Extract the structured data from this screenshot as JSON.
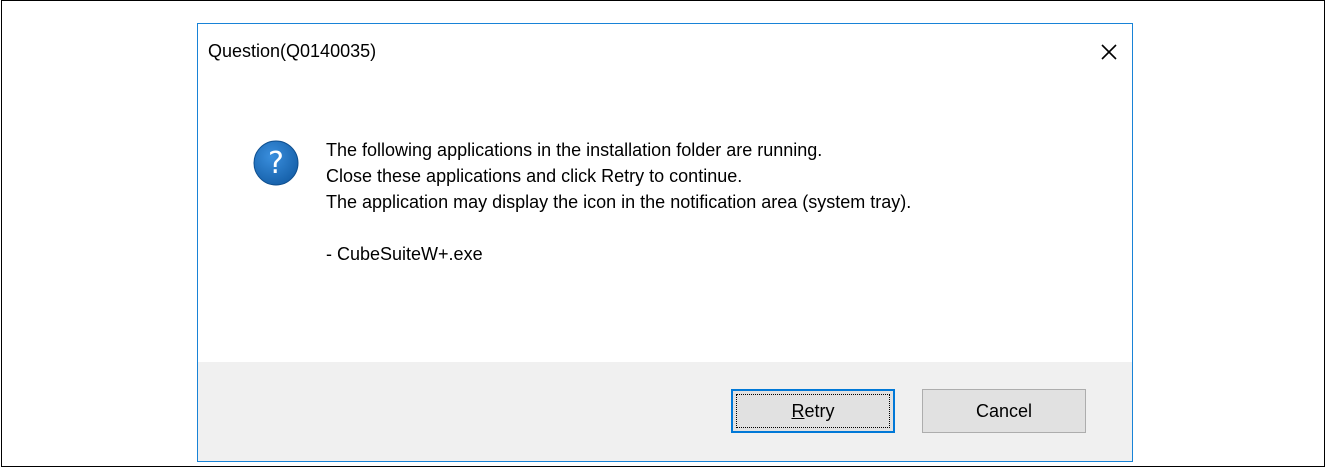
{
  "dialog": {
    "title": "Question(Q0140035)",
    "close_icon": "close-icon",
    "icon": "question-icon",
    "icon_glyph": "?",
    "message_lines": [
      "The following applications in the installation folder are running.",
      "Close these applications and click Retry to continue.",
      "The application may display the icon in the notification area (system tray)."
    ],
    "application_item": "- CubeSuiteW+.exe",
    "buttons": {
      "retry_mnemonic": "R",
      "retry_rest": "etry",
      "cancel": "Cancel"
    }
  },
  "colors": {
    "accent": "#0078d7",
    "dialog_border": "#1883d7",
    "footer_background": "#f0f0f0",
    "question_icon": "#1e6fbb"
  }
}
